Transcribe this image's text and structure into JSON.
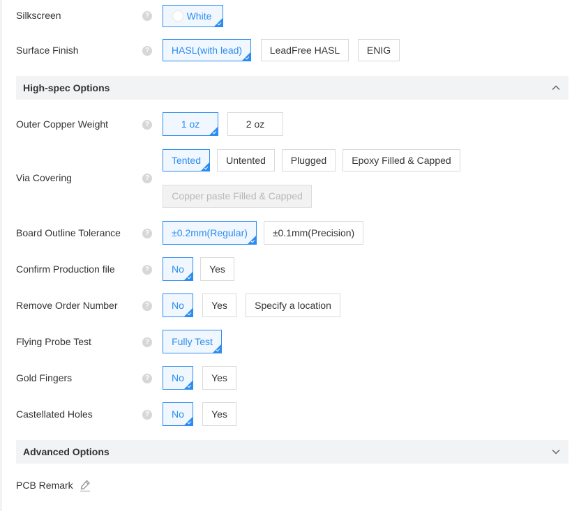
{
  "silkscreen": {
    "label": "Silkscreen",
    "options": [
      "White"
    ],
    "selected": 0
  },
  "surface_finish": {
    "label": "Surface Finish",
    "options": [
      "HASL(with lead)",
      "LeadFree HASL",
      "ENIG"
    ],
    "selected": 0
  },
  "high_spec": {
    "title": "High-spec Options",
    "outer_copper": {
      "label": "Outer Copper Weight",
      "options": [
        "1 oz",
        "2 oz"
      ],
      "selected": 0
    },
    "via_covering": {
      "label": "Via Covering",
      "options": [
        "Tented",
        "Untented",
        "Plugged",
        "Epoxy Filled & Capped",
        "Copper paste Filled & Capped"
      ],
      "selected": 0,
      "disabled": [
        4
      ]
    },
    "outline_tolerance": {
      "label": "Board Outline Tolerance",
      "options": [
        "±0.2mm(Regular)",
        "±0.1mm(Precision)"
      ],
      "selected": 0
    },
    "confirm_production": {
      "label": "Confirm Production file",
      "options": [
        "No",
        "Yes"
      ],
      "selected": 0
    },
    "remove_order_number": {
      "label": "Remove Order Number",
      "options": [
        "No",
        "Yes",
        "Specify a location"
      ],
      "selected": 0
    },
    "flying_probe": {
      "label": "Flying Probe Test",
      "options": [
        "Fully Test"
      ],
      "selected": 0
    },
    "gold_fingers": {
      "label": "Gold Fingers",
      "options": [
        "No",
        "Yes"
      ],
      "selected": 0
    },
    "castellated": {
      "label": "Castellated Holes",
      "options": [
        "No",
        "Yes"
      ],
      "selected": 0
    }
  },
  "advanced": {
    "title": "Advanced Options"
  },
  "pcb_remark": {
    "label": "PCB Remark"
  },
  "help_glyph": "?",
  "icons": {
    "help": "question-circle-icon",
    "collapse": "chevron-up-icon",
    "expand": "chevron-down-icon",
    "edit": "pencil-icon"
  },
  "colors": {
    "accent": "#2d8cf0",
    "section_bg": "#f2f3f5",
    "disabled_bg": "#f2f2f2",
    "help_icon": "#d7d7d7"
  }
}
